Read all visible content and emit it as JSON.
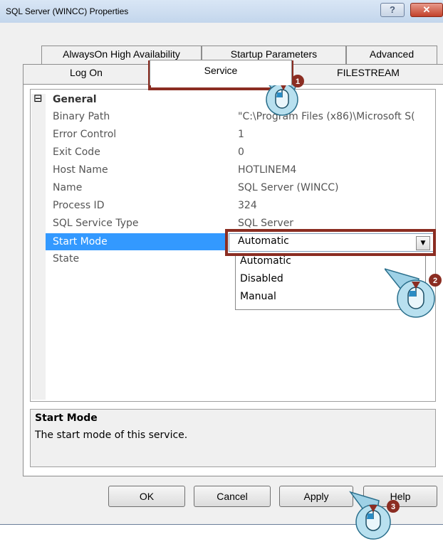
{
  "window": {
    "title": "SQL Server (WINCC) Properties",
    "help_glyph": "?",
    "close_glyph": "✕"
  },
  "tabs": {
    "row1": [
      "AlwaysOn High Availability",
      "Startup Parameters",
      "Advanced"
    ],
    "row2": [
      "Log On",
      "Service",
      "FILESTREAM"
    ],
    "active": "Service"
  },
  "grid": {
    "section_toggle": "⊟",
    "section": "General",
    "rows": [
      {
        "name": "Binary Path",
        "value": "\"C:\\Program Files (x86)\\Microsoft S("
      },
      {
        "name": "Error Control",
        "value": "1"
      },
      {
        "name": "Exit Code",
        "value": "0"
      },
      {
        "name": "Host Name",
        "value": "HOTLINEM4"
      },
      {
        "name": "Name",
        "value": "SQL Server (WINCC)"
      },
      {
        "name": "Process ID",
        "value": "324"
      },
      {
        "name": "SQL Service Type",
        "value": "SQL Server"
      },
      {
        "name": "Start Mode",
        "value": "Automatic"
      },
      {
        "name": "State",
        "value": ""
      }
    ]
  },
  "start_mode_dropdown": {
    "selected": "Automatic",
    "arrow_glyph": "▼",
    "options": [
      "Automatic",
      "Disabled",
      "Manual"
    ]
  },
  "description": {
    "title": "Start Mode",
    "text": "The start mode of this service."
  },
  "buttons": {
    "ok": "OK",
    "cancel": "Cancel",
    "apply": "Apply",
    "help": "Help"
  },
  "step_badges": [
    "1",
    "2",
    "3"
  ],
  "colors": {
    "highlight_box": "#8b2d22",
    "selection": "#3399ff",
    "title_bar": "#c5d7ec"
  }
}
